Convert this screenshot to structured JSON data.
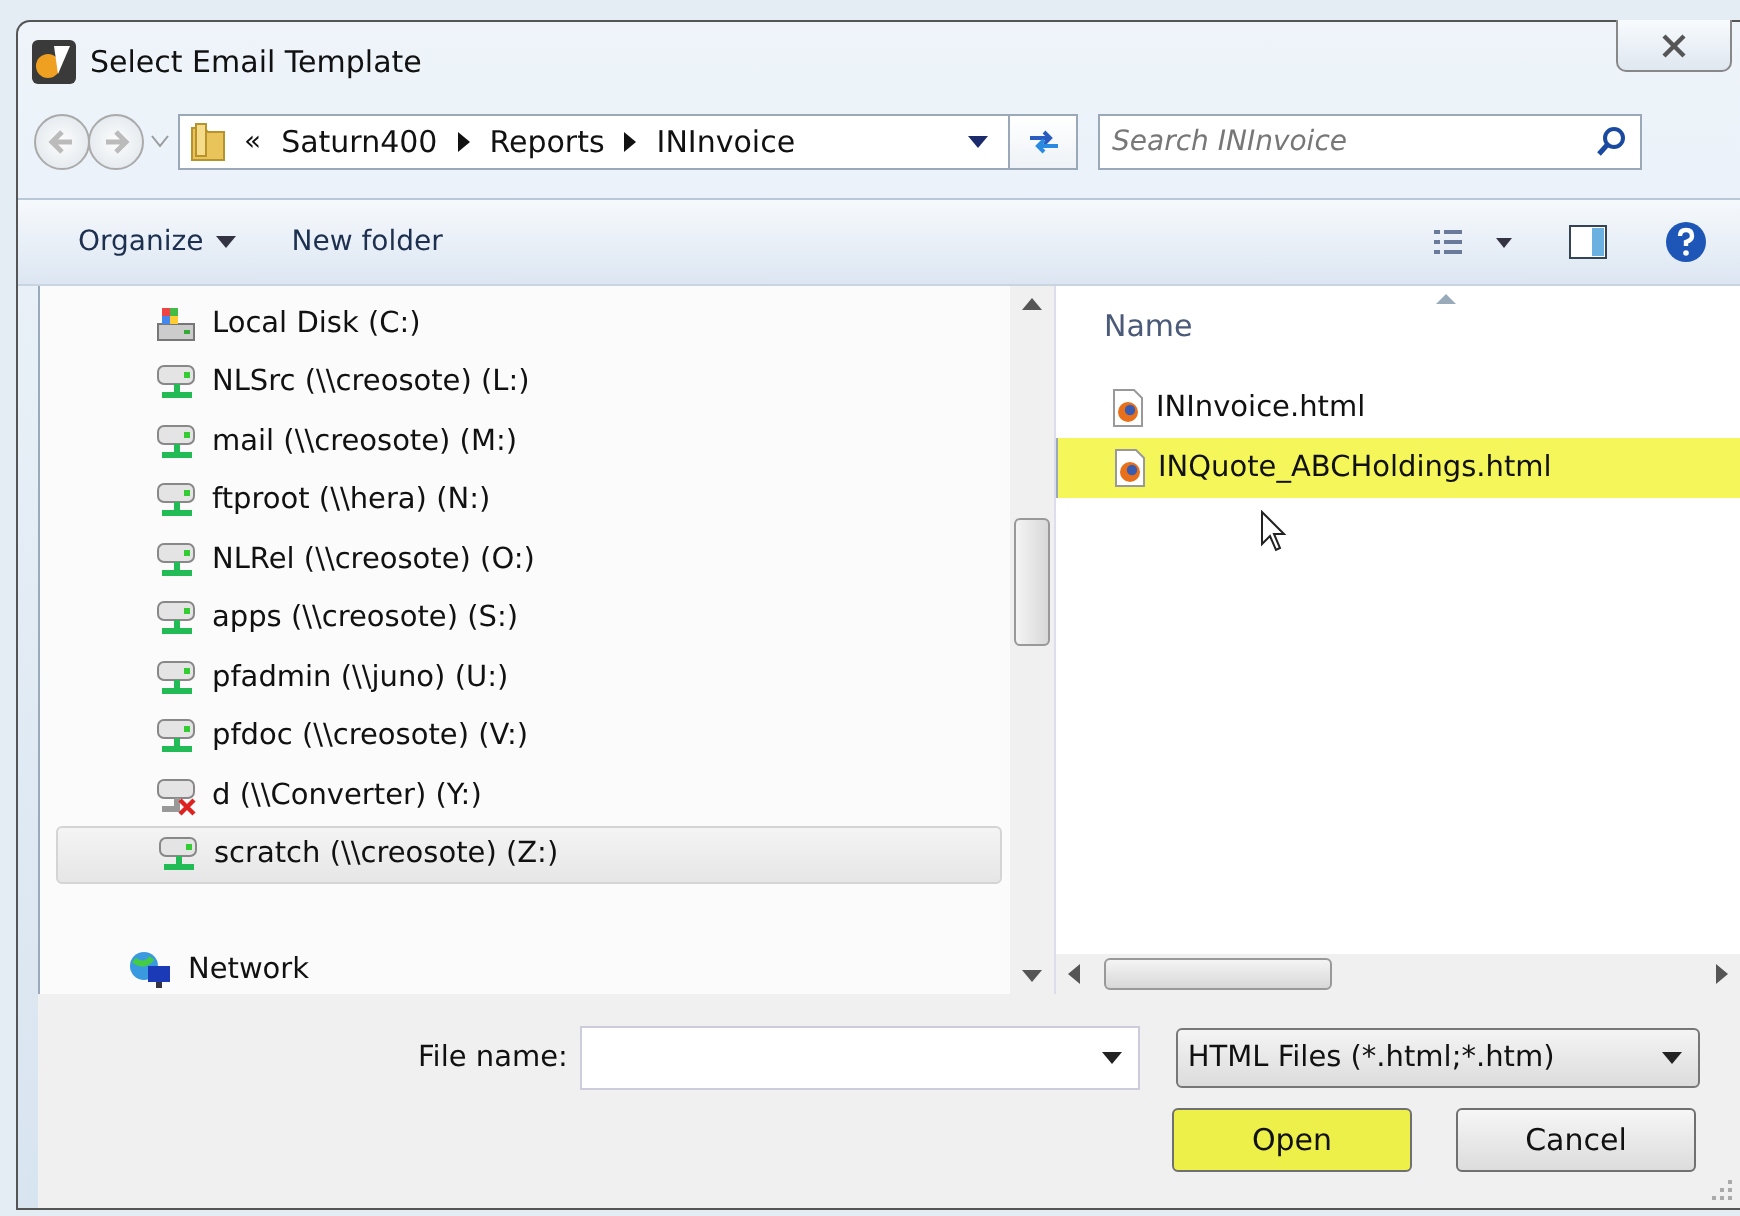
{
  "window": {
    "title": "Select Email Template"
  },
  "address": {
    "overflow": "«",
    "crumbs": [
      "Saturn400",
      "Reports",
      "INInvoice"
    ]
  },
  "search": {
    "placeholder": "Search INInvoice"
  },
  "toolbar": {
    "organize": "Organize",
    "new_folder": "New folder"
  },
  "sidebar": {
    "items": [
      {
        "label": "Local Disk (C:)",
        "kind": "local",
        "selected": false
      },
      {
        "label": "NLSrc (\\\\creosote) (L:)",
        "kind": "share",
        "selected": false
      },
      {
        "label": "mail (\\\\creosote) (M:)",
        "kind": "share",
        "selected": false
      },
      {
        "label": "ftproot (\\\\hera) (N:)",
        "kind": "share",
        "selected": false
      },
      {
        "label": "NLRel (\\\\creosote) (O:)",
        "kind": "share",
        "selected": false
      },
      {
        "label": "apps (\\\\creosote) (S:)",
        "kind": "share",
        "selected": false
      },
      {
        "label": "pfadmin (\\\\juno) (U:)",
        "kind": "share",
        "selected": false
      },
      {
        "label": "pfdoc (\\\\creosote) (V:)",
        "kind": "share",
        "selected": false
      },
      {
        "label": "d (\\\\Converter) (Y:)",
        "kind": "disconnected",
        "selected": false
      },
      {
        "label": "scratch (\\\\creosote) (Z:)",
        "kind": "share",
        "selected": true
      }
    ],
    "network": "Network"
  },
  "files": {
    "column": "Name",
    "items": [
      {
        "name": "INInvoice.html",
        "selected": false
      },
      {
        "name": "INQuote_ABCHoldings.html",
        "selected": true
      }
    ]
  },
  "footer": {
    "file_name_label": "File name:",
    "file_type": "HTML Files (*.html;*.htm)",
    "buttons": [
      {
        "label": "Open",
        "highlighted": true
      },
      {
        "label": "Cancel",
        "highlighted": false
      }
    ]
  }
}
